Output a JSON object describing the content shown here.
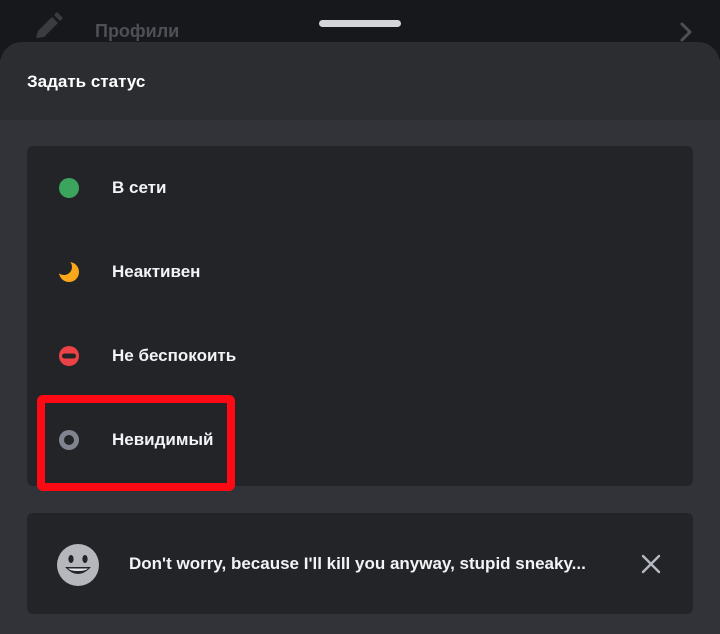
{
  "background_row": {
    "label": "Профили"
  },
  "sheet": {
    "title": "Задать статус"
  },
  "statuses": [
    {
      "label": "В сети",
      "icon": "online-dot-icon",
      "color": "#3ba55d"
    },
    {
      "label": "Неактивен",
      "icon": "moon-icon",
      "color": "#faa81a"
    },
    {
      "label": "Не беспокоить",
      "icon": "dnd-icon",
      "color": "#ed4245"
    },
    {
      "label": "Невидимый",
      "icon": "invisible-icon",
      "color": "#80848e"
    }
  ],
  "highlighted_status": "Невидимый",
  "custom_status": {
    "text": "Don't worry, because I'll kill you anyway, stupid sneaky...",
    "emoji": "grinning-face-icon",
    "clear_icon": "close-icon"
  },
  "colors": {
    "highlight": "#ff0a14",
    "card": "#232428",
    "sheet": "#2b2d31"
  }
}
